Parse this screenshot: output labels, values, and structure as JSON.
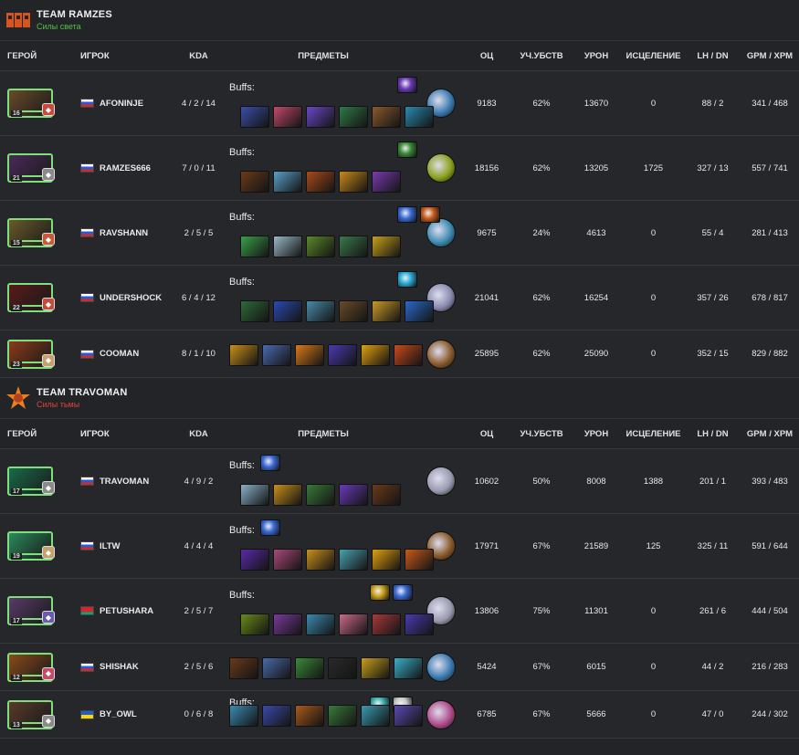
{
  "columns": {
    "hero": "ГЕРОЙ",
    "player": "ИГРОК",
    "kda": "KDA",
    "items": "ПРЕДМЕТЫ",
    "nw": "ОЦ",
    "participation": "УЧ.УБСТВ",
    "damage": "УРОН",
    "healing": "ИСЦЕЛЕНИЕ",
    "lhdn": "LH / DN",
    "gpm": "GPM / XPM"
  },
  "buffs_label": "Buffs:",
  "colors": {
    "radiant_side": "#4fc34a",
    "dire_side": "#e0423a",
    "portrait_border": "#7ee07a"
  },
  "teams": [
    {
      "name": "TEAM RAMZES",
      "side": "Силы света",
      "logo_icon": "team-ramzes-logo",
      "players": [
        {
          "level": "16",
          "flag": "ru",
          "name": "AFONINJE",
          "kda": "4 / 2 / 14",
          "has_buffs": true,
          "nw": "9183",
          "participation": "62%",
          "damage": "13670",
          "healing": "0",
          "lhdn": "88 / 2",
          "gpm": "341 / 468"
        },
        {
          "level": "21",
          "flag": "ru",
          "name": "RAMZES666",
          "kda": "7 / 0 / 11",
          "has_buffs": true,
          "nw": "18156",
          "participation": "62%",
          "damage": "13205",
          "healing": "1725",
          "lhdn": "327 / 13",
          "gpm": "557 / 741"
        },
        {
          "level": "15",
          "flag": "ru",
          "name": "RAVSHANN",
          "kda": "2 / 5 / 5",
          "has_buffs": true,
          "nw": "9675",
          "participation": "24%",
          "damage": "4613",
          "healing": "0",
          "lhdn": "55 / 4",
          "gpm": "281 / 413"
        },
        {
          "level": "22",
          "flag": "ru",
          "name": "UNDERSHOCK",
          "kda": "6 / 4 / 12",
          "has_buffs": true,
          "nw": "21041",
          "participation": "62%",
          "damage": "16254",
          "healing": "0",
          "lhdn": "357 / 26",
          "gpm": "678 / 817"
        },
        {
          "level": "23",
          "flag": "ru",
          "name": "COOMAN",
          "kda": "8 / 1 / 10",
          "has_buffs": false,
          "nw": "25895",
          "participation": "62%",
          "damage": "25090",
          "healing": "0",
          "lhdn": "352 / 15",
          "gpm": "829 / 882"
        }
      ]
    },
    {
      "name": "TEAM TRAVOMAN",
      "side": "Силы тьмы",
      "logo_icon": "team-travoman-logo",
      "players": [
        {
          "level": "17",
          "flag": "ru",
          "name": "TRAVOMAN",
          "kda": "4 / 9 / 2",
          "has_buffs": true,
          "nw": "10602",
          "participation": "50%",
          "damage": "8008",
          "healing": "1388",
          "lhdn": "201 / 1",
          "gpm": "393 / 483"
        },
        {
          "level": "19",
          "flag": "ru",
          "name": "ILTW",
          "kda": "4 / 4 / 4",
          "has_buffs": true,
          "nw": "17971",
          "participation": "67%",
          "damage": "21589",
          "healing": "125",
          "lhdn": "325 / 11",
          "gpm": "591 / 644"
        },
        {
          "level": "17",
          "flag": "by",
          "name": "PETUSHARA",
          "kda": "2 / 5 / 7",
          "has_buffs": true,
          "nw": "13806",
          "participation": "75%",
          "damage": "11301",
          "healing": "0",
          "lhdn": "261 / 6",
          "gpm": "444 / 504"
        },
        {
          "level": "12",
          "flag": "ru",
          "name": "SHISHAK",
          "kda": "2 / 5 / 6",
          "has_buffs": false,
          "nw": "5424",
          "participation": "67%",
          "damage": "6015",
          "healing": "0",
          "lhdn": "44 / 2",
          "gpm": "216 / 283"
        },
        {
          "level": "13",
          "flag": "ua",
          "name": "BY_OWL",
          "kda": "0 / 6 / 8",
          "has_buffs": true,
          "nw": "6785",
          "participation": "67%",
          "damage": "5666",
          "healing": "0",
          "lhdn": "47 / 0",
          "gpm": "244 / 302"
        }
      ]
    }
  ]
}
